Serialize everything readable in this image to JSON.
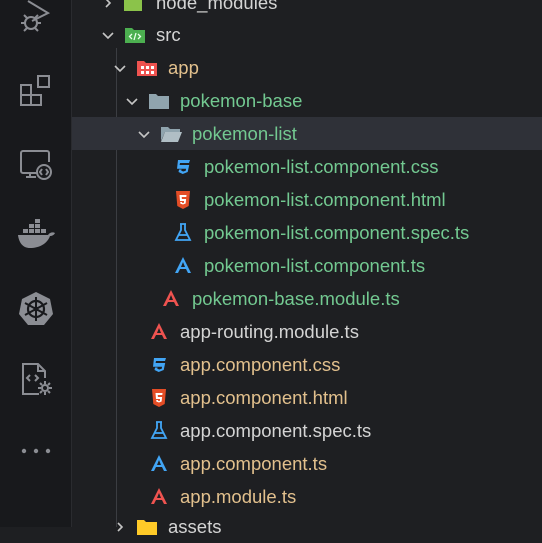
{
  "activity_bar": {
    "items": [
      {
        "name": "run-debug",
        "icon": "run-debug-icon"
      },
      {
        "name": "extensions",
        "icon": "extensions-icon"
      },
      {
        "name": "remote-explorer",
        "icon": "remote-explorer-icon"
      },
      {
        "name": "docker",
        "icon": "docker-icon"
      },
      {
        "name": "kubernetes",
        "icon": "kubernetes-icon"
      },
      {
        "name": "debug-config",
        "icon": "file-gear-icon"
      },
      {
        "name": "more",
        "icon": "more-icon"
      }
    ]
  },
  "tree": {
    "colors": {
      "untracked": "#73c991",
      "modified": "#e2c08d",
      "default": "#d4d4d4",
      "selection": "#2f3138"
    },
    "items": [
      {
        "label": "node_modules",
        "icon": "node-modules-folder-icon",
        "status": "default"
      },
      {
        "label": "src",
        "icon": "src-folder-icon",
        "status": "default",
        "expanded": true
      },
      {
        "label": "app",
        "icon": "app-folder-icon",
        "status": "modified",
        "expanded": true
      },
      {
        "label": "pokemon-base",
        "icon": "folder-icon",
        "status": "untracked",
        "expanded": true
      },
      {
        "label": "pokemon-list",
        "icon": "folder-open-icon",
        "status": "untracked",
        "expanded": true,
        "selected": true
      },
      {
        "label": "pokemon-list.component.css",
        "icon": "css-icon",
        "status": "untracked"
      },
      {
        "label": "pokemon-list.component.html",
        "icon": "html-icon",
        "status": "untracked"
      },
      {
        "label": "pokemon-list.component.spec.ts",
        "icon": "test-flask-icon",
        "status": "untracked"
      },
      {
        "label": "pokemon-list.component.ts",
        "icon": "angular-component-icon",
        "status": "untracked"
      },
      {
        "label": "pokemon-base.module.ts",
        "icon": "angular-icon",
        "status": "untracked"
      },
      {
        "label": "app-routing.module.ts",
        "icon": "angular-icon",
        "status": "default"
      },
      {
        "label": "app.component.css",
        "icon": "css-icon",
        "status": "modified"
      },
      {
        "label": "app.component.html",
        "icon": "html-icon",
        "status": "modified"
      },
      {
        "label": "app.component.spec.ts",
        "icon": "test-flask-icon",
        "status": "default"
      },
      {
        "label": "app.component.ts",
        "icon": "angular-component-icon",
        "status": "modified"
      },
      {
        "label": "app.module.ts",
        "icon": "angular-icon",
        "status": "modified"
      },
      {
        "label": "assets",
        "icon": "assets-folder-icon",
        "status": "default"
      }
    ]
  }
}
